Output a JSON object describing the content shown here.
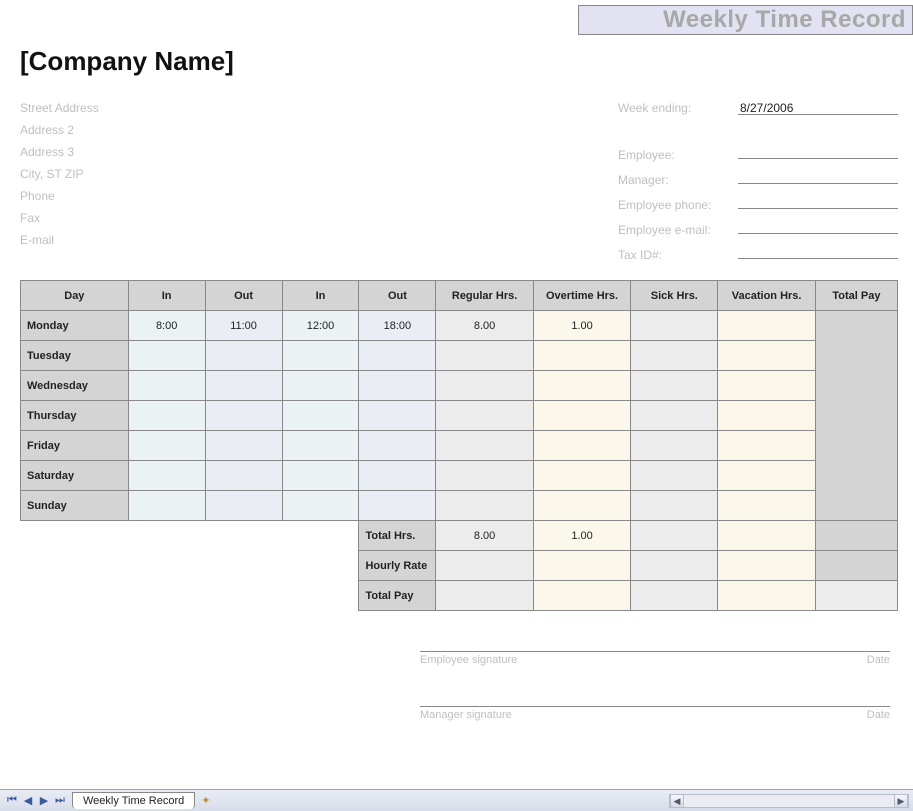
{
  "header": {
    "title_box": "Weekly Time Record",
    "company_name": "[Company Name]"
  },
  "address": {
    "street": "Street Address",
    "line2": "Address 2",
    "line3": "Address 3",
    "city": "City, ST  ZIP",
    "phone": "Phone",
    "fax": "Fax",
    "email": "E-mail"
  },
  "meta": {
    "week_ending_label": "Week ending:",
    "week_ending_value": "8/27/2006",
    "employee_label": "Employee:",
    "manager_label": "Manager:",
    "emp_phone_label": "Employee phone:",
    "emp_email_label": "Employee e-mail:",
    "tax_id_label": "Tax ID#:"
  },
  "columns": {
    "day": "Day",
    "in1": "In",
    "out1": "Out",
    "in2": "In",
    "out2": "Out",
    "reg": "Regular Hrs.",
    "ot": "Overtime Hrs.",
    "sick": "Sick Hrs.",
    "vac": "Vacation Hrs.",
    "total": "Total Pay"
  },
  "rows": [
    {
      "day": "Monday",
      "in1": "8:00",
      "out1": "11:00",
      "in2": "12:00",
      "out2": "18:00",
      "reg": "8.00",
      "ot": "1.00",
      "sick": "",
      "vac": ""
    },
    {
      "day": "Tuesday",
      "in1": "",
      "out1": "",
      "in2": "",
      "out2": "",
      "reg": "",
      "ot": "",
      "sick": "",
      "vac": ""
    },
    {
      "day": "Wednesday",
      "in1": "",
      "out1": "",
      "in2": "",
      "out2": "",
      "reg": "",
      "ot": "",
      "sick": "",
      "vac": ""
    },
    {
      "day": "Thursday",
      "in1": "",
      "out1": "",
      "in2": "",
      "out2": "",
      "reg": "",
      "ot": "",
      "sick": "",
      "vac": ""
    },
    {
      "day": "Friday",
      "in1": "",
      "out1": "",
      "in2": "",
      "out2": "",
      "reg": "",
      "ot": "",
      "sick": "",
      "vac": ""
    },
    {
      "day": "Saturday",
      "in1": "",
      "out1": "",
      "in2": "",
      "out2": "",
      "reg": "",
      "ot": "",
      "sick": "",
      "vac": ""
    },
    {
      "day": "Sunday",
      "in1": "",
      "out1": "",
      "in2": "",
      "out2": "",
      "reg": "",
      "ot": "",
      "sick": "",
      "vac": ""
    }
  ],
  "summary": {
    "total_hrs_label": "Total Hrs.",
    "total_reg": "8.00",
    "total_ot": "1.00",
    "hourly_rate_label": "Hourly Rate",
    "total_pay_label": "Total Pay"
  },
  "signatures": {
    "employee": "Employee signature",
    "manager": "Manager signature",
    "date": "Date"
  },
  "tabs": {
    "sheet1": "Weekly Time Record"
  }
}
